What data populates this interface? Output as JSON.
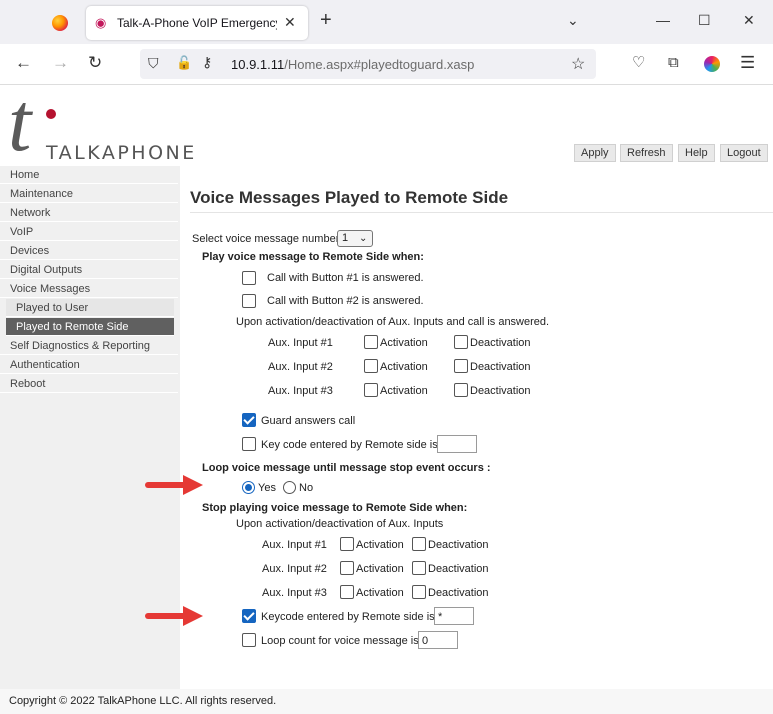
{
  "browser": {
    "tab_title": "Talk-A-Phone VoIP Emergency Ph",
    "url_host": "10.9.1.11",
    "url_path": "/Home.aspx#playedtoguard.xasp"
  },
  "header": {
    "logo_text": "TALKAPHONE",
    "buttons": [
      "Apply",
      "Refresh",
      "Help",
      "Logout"
    ]
  },
  "sidebar": {
    "items": [
      "Home",
      "Maintenance",
      "Network",
      "VoIP",
      "Devices",
      "Digital Outputs",
      "Voice Messages",
      "Played to User",
      "Played to Remote Side",
      "Self Diagnostics & Reporting",
      "Authentication",
      "Reboot"
    ],
    "active": "Played to Remote Side"
  },
  "main": {
    "title": "Voice Messages Played to Remote Side",
    "select_label": "Select voice message number",
    "select_value": "1",
    "play_heading": "Play voice message to Remote Side when:",
    "call_btn1": "Call with Button #1 is answered.",
    "call_btn2": "Call with Button #2 is answered.",
    "upon_call": "Upon activation/deactivation of Aux. Inputs and call is answered.",
    "aux1": "Aux. Input #1",
    "aux2": "Aux. Input #2",
    "aux3": "Aux. Input #3",
    "activation": "Activation",
    "deactivation": "Deactivation",
    "guard_answers": "Guard answers call",
    "guard_answers_checked": true,
    "keycode_label": "Key code entered by Remote side is",
    "keycode_value": "",
    "loop_heading": "Loop voice message until message stop event occurs :",
    "yes": "Yes",
    "no": "No",
    "loop_selected": "Yes",
    "stop_heading": "Stop playing voice message to Remote Side when:",
    "upon_stop": "Upon activation/deactivation of Aux. Inputs",
    "stop_keycode_label": "Keycode entered by Remote side is",
    "stop_keycode_value": "*",
    "stop_keycode_checked": true,
    "loop_count_label": "Loop count for voice message is",
    "loop_count_value": "0"
  },
  "footer": {
    "copyright": "Copyright © 2022 TalkAPhone LLC. All rights reserved."
  },
  "colors": {
    "accent": "#1565c0",
    "annotation_arrow": "#e53935",
    "logo_dot": "#b5122f"
  }
}
